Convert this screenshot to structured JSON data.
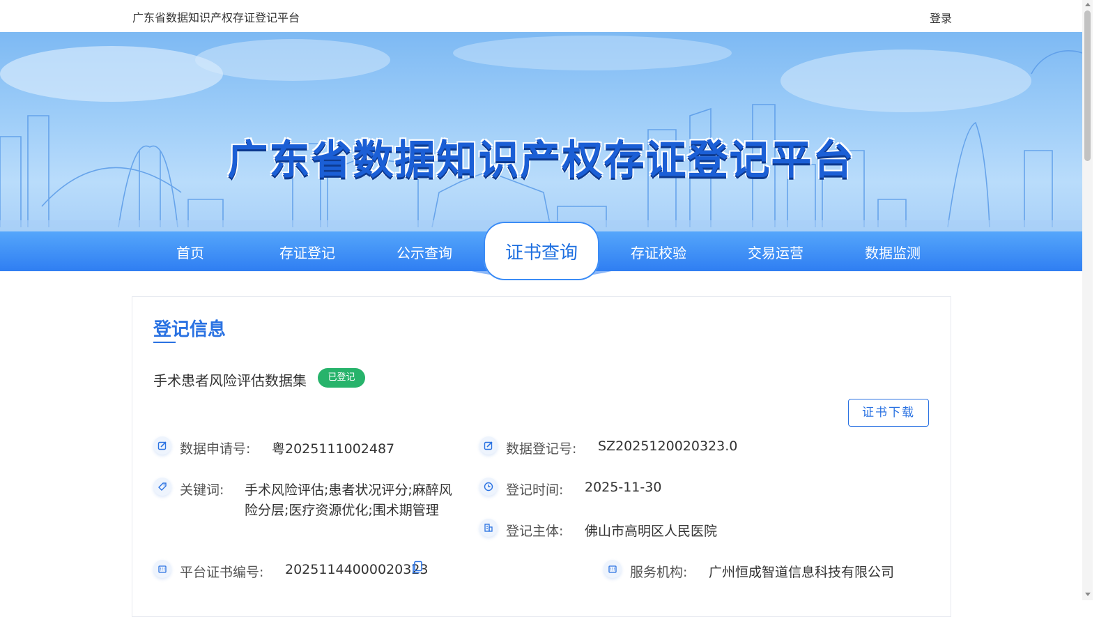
{
  "header": {
    "site_name": "广东省数据知识产权存证登记平台",
    "login": "登录"
  },
  "banner": {
    "title": "广东省数据知识产权存证登记平台"
  },
  "nav": {
    "items": [
      "首页",
      "存证登记",
      "公示查询",
      "证书查询",
      "存证校验",
      "交易运营",
      "数据监测"
    ],
    "active": "证书查询"
  },
  "panel": {
    "title": "登记信息",
    "dataset_name": "手术患者风险评估数据集",
    "status_badge": "已登记",
    "download_button": "证书下载",
    "fields": {
      "application_no_label": "数据申请号:",
      "application_no": "粤2025111002487",
      "registration_no_label": "数据登记号:",
      "registration_no": "SZ2025120020323.0",
      "keywords_label": "关键词:",
      "keywords_line1": "手术风险评估;患者状况评分;麻醉风",
      "keywords_line2": "险分层;医疗资源优化;围术期管理",
      "reg_time_label": "登记时间:",
      "reg_time": "2025-11-30",
      "reg_subject_label": "登记主体:",
      "reg_subject": "佛山市高明区人民医院",
      "cert_no_label": "平台证书编号:",
      "cert_no": "20251144000020323",
      "service_org_label": "服务机构:",
      "service_org": "广州恒成智道信息科技有限公司"
    }
  },
  "colors": {
    "primary": "#2a72e2",
    "nav": "#2f7ef2",
    "badge_green": "#27b36b"
  },
  "icons": [
    "edit-icon",
    "tag-icon",
    "clock-icon",
    "building-icon",
    "calendar-icon",
    "copy-icon"
  ]
}
